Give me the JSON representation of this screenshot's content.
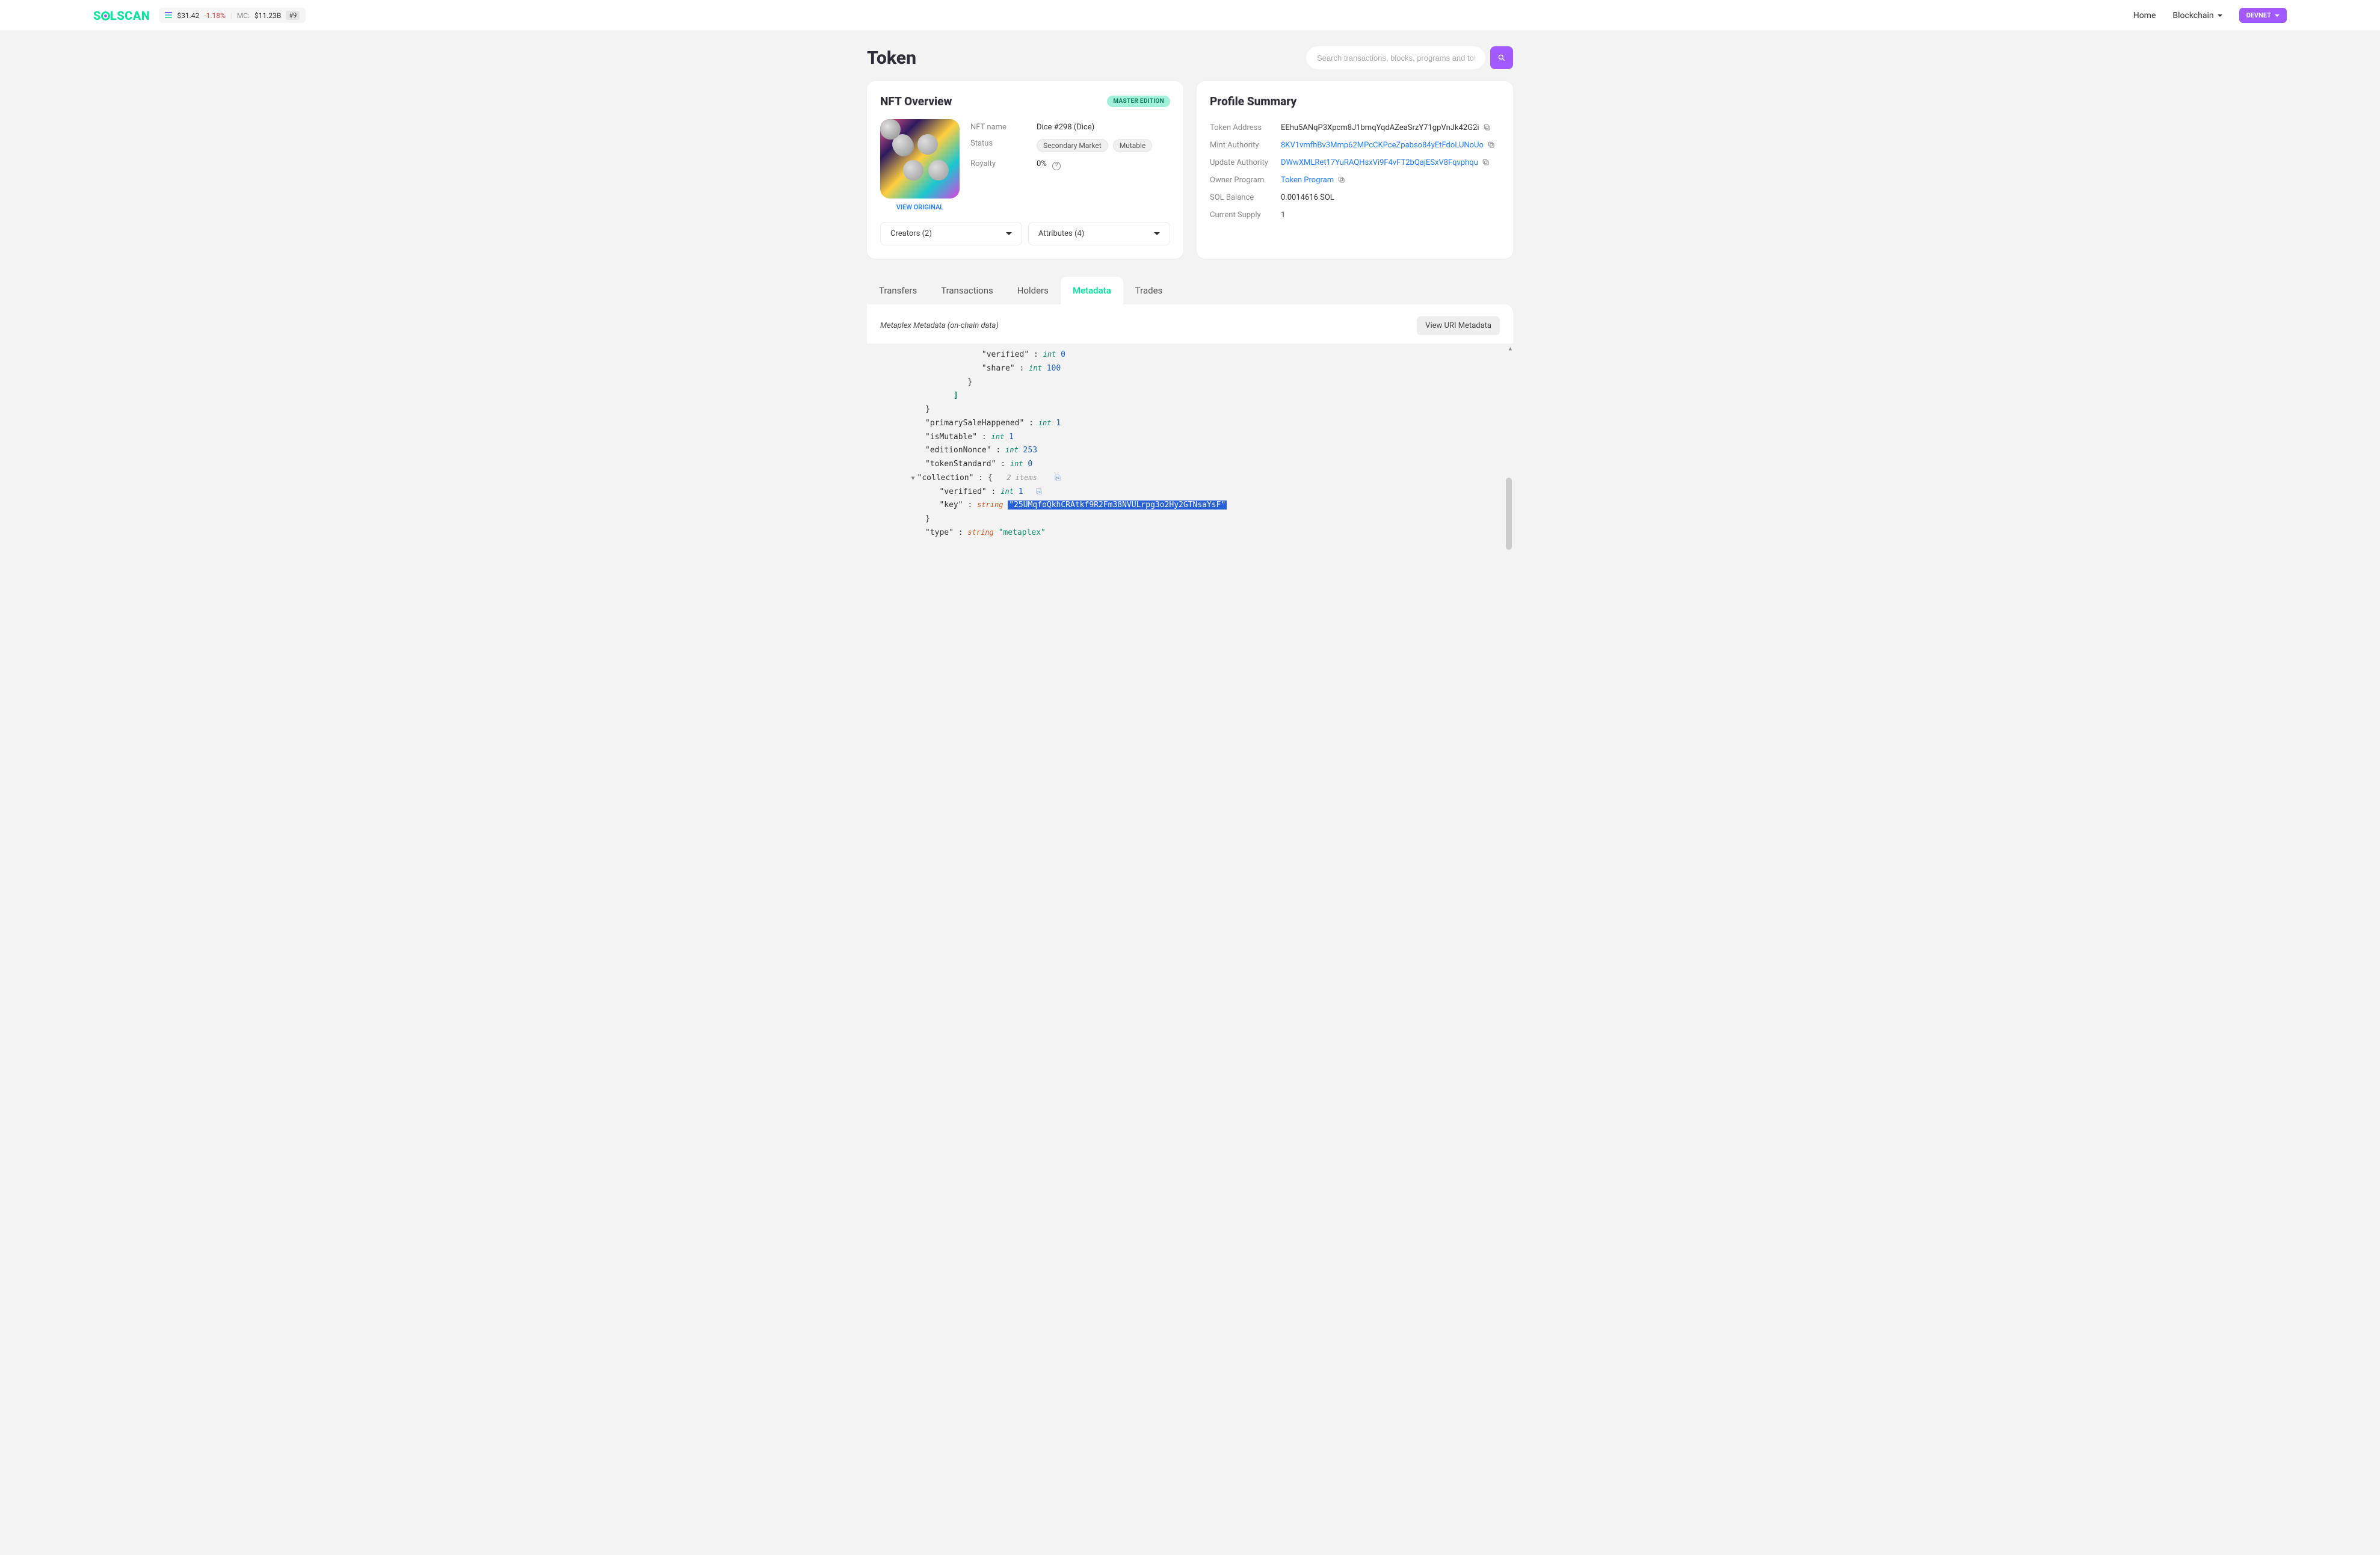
{
  "header": {
    "logo_text": "SOLSCAN",
    "price": "$31.42",
    "price_delta": "-1.18%",
    "mc_label": "MC:",
    "mc_value": "$11.23B",
    "rank": "#9",
    "nav": {
      "home": "Home",
      "blockchain": "Blockchain"
    },
    "cluster": "DEVNET"
  },
  "page": {
    "title": "Token",
    "search_placeholder": "Search transactions, blocks, programs and tokens"
  },
  "overview": {
    "title": "NFT Overview",
    "badge": "MASTER EDITION",
    "view_original": "VIEW ORIGINAL",
    "labels": {
      "name": "NFT name",
      "status": "Status",
      "royalty": "Royalty"
    },
    "name": "Dice #298 (Dice)",
    "status_tags": [
      "Secondary Market",
      "Mutable"
    ],
    "royalty": "0%",
    "dropdowns": {
      "creators": "Creators (2)",
      "attributes": "Attributes (4)"
    }
  },
  "profile": {
    "title": "Profile Summary",
    "labels": {
      "token_address": "Token Address",
      "mint_authority": "Mint Authority",
      "update_authority": "Update Authority",
      "owner_program": "Owner Program",
      "sol_balance": "SOL Balance",
      "current_supply": "Current Supply"
    },
    "token_address": "EEhu5ANqP3Xpcm8J1bmqYqdAZeaSrzY71gpVnJk42G2i",
    "mint_authority": "8KV1vmfhBv3Mmp62MPcCKPceZpabso84yEtFdoLUNoUo",
    "update_authority": "DWwXMLRet17YuRAQHsxVi9F4vFT2bQajESxV8Fqvphqu",
    "owner_program": "Token Program",
    "sol_balance": "0.0014616 SOL",
    "current_supply": "1"
  },
  "tabs": {
    "transfers": "Transfers",
    "transactions": "Transactions",
    "holders": "Holders",
    "metadata": "Metadata",
    "trades": "Trades"
  },
  "metadata": {
    "title": "Metaplex Metadata (on-chain data)",
    "uri_button": "View URI Metadata",
    "json": {
      "verified_label": "\"verified\"",
      "share_label": "\"share\"",
      "verified_val": "0",
      "share_val": "100",
      "primarySale_label": "\"primarySaleHappened\"",
      "primarySale_val": "1",
      "isMutable_label": "\"isMutable\"",
      "isMutable_val": "1",
      "editionNonce_label": "\"editionNonce\"",
      "editionNonce_val": "253",
      "tokenStandard_label": "\"tokenStandard\"",
      "tokenStandard_val": "0",
      "collection_label": "\"collection\"",
      "collection_items": "2 items",
      "coll_verified_label": "\"verified\"",
      "coll_verified_val": "1",
      "coll_key_label": "\"key\"",
      "coll_key_val": "\"25UMqfoQkhCRAtkf9R2Fm38NVULrpg3o2Hy2GTNsaYsF\"",
      "type_label": "\"type\"",
      "type_val": "\"metaplex\"",
      "int_t": "int",
      "str_t": "string"
    }
  }
}
